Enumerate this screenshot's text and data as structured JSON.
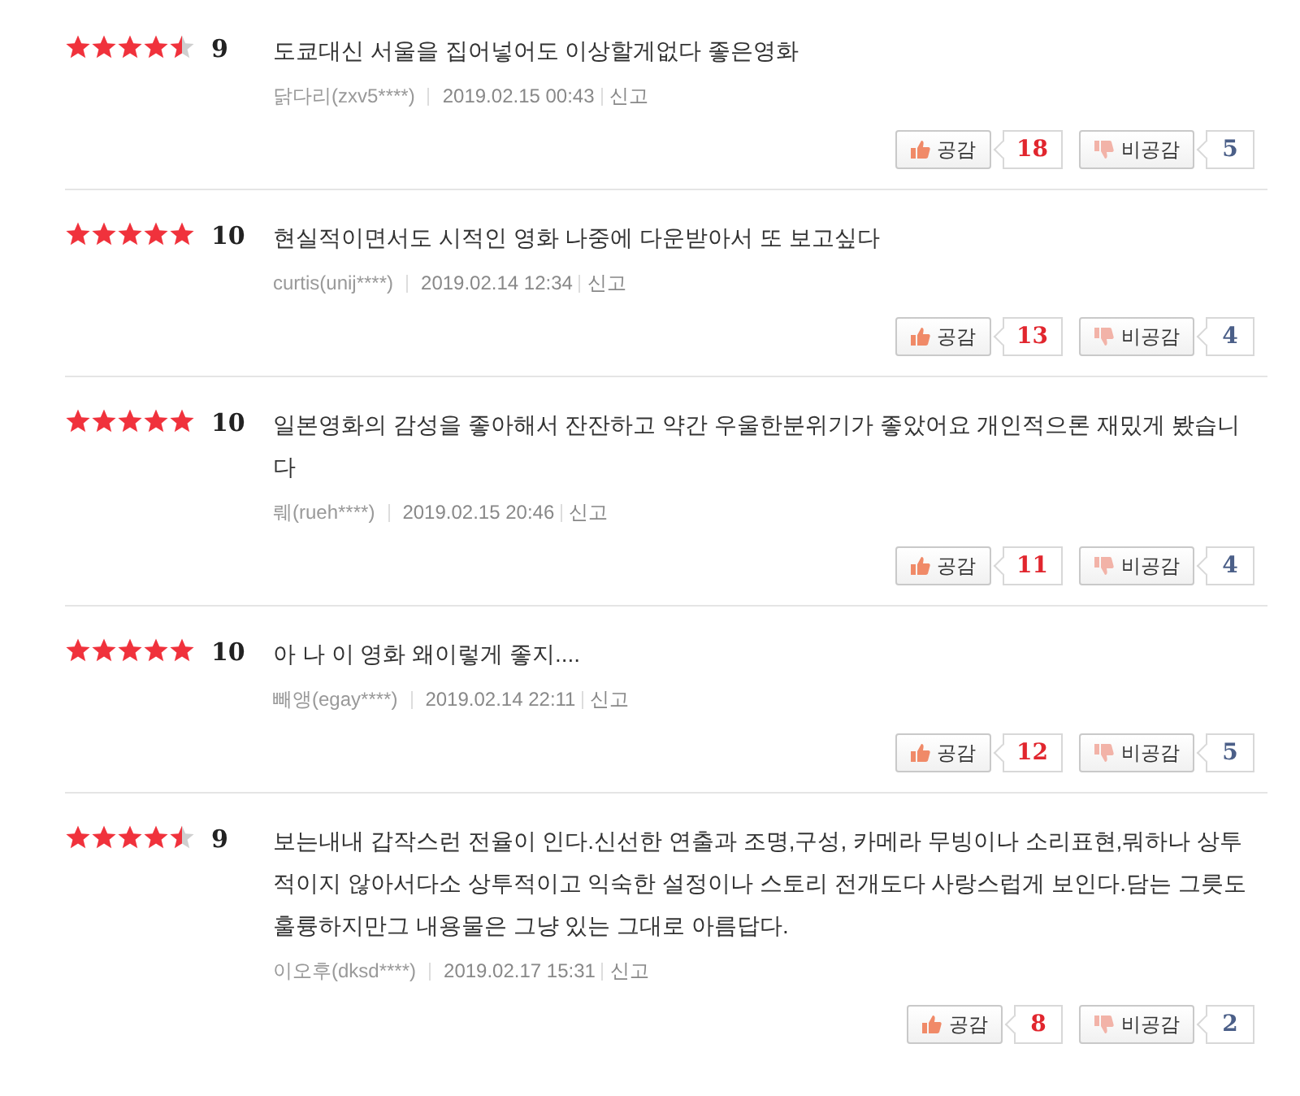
{
  "reviews": [
    {
      "stars": 4.5,
      "score": "9",
      "text": "도쿄대신 서울을 집어넣어도 이상할게없다 좋은영화",
      "author": "닭다리(zxv5****)",
      "date": "2019.02.15 00:43",
      "report": "신고",
      "like_label": "공감",
      "likes": "18",
      "dislike_label": "비공감",
      "dislikes": "5"
    },
    {
      "stars": 5,
      "score": "10",
      "text": "현실적이면서도 시적인 영화 나중에 다운받아서 또 보고싶다",
      "author": "curtis(unij****)",
      "date": "2019.02.14 12:34",
      "report": "신고",
      "like_label": "공감",
      "likes": "13",
      "dislike_label": "비공감",
      "dislikes": "4"
    },
    {
      "stars": 5,
      "score": "10",
      "text": "일본영화의 감성을 좋아해서 잔잔하고 약간 우울한분위기가 좋았어요 개인적으론 재밌게 봤습니다",
      "author": "뤠(rueh****)",
      "date": "2019.02.15 20:46",
      "report": "신고",
      "like_label": "공감",
      "likes": "11",
      "dislike_label": "비공감",
      "dislikes": "4"
    },
    {
      "stars": 5,
      "score": "10",
      "text": "아 나 이 영화 왜이렇게 좋지....",
      "author": "빼앵(egay****)",
      "date": "2019.02.14 22:11",
      "report": "신고",
      "like_label": "공감",
      "likes": "12",
      "dislike_label": "비공감",
      "dislikes": "5"
    },
    {
      "stars": 4.5,
      "score": "9",
      "text": "보는내내 갑작스런 전율이 인다.신선한 연출과 조명,구성, 카메라 무빙이나 소리표현,뭐하나 상투적이지 않아서다소 상투적이고 익숙한 설정이나 스토리 전개도다 사랑스럽게 보인다.담는 그릇도 훌륭하지만그 내용물은 그냥 있는 그대로 아름답다.",
      "author": "이오후(dksd****)",
      "date": "2019.02.17 15:31",
      "report": "신고",
      "like_label": "공감",
      "likes": "8",
      "dislike_label": "비공감",
      "dislikes": "2"
    }
  ]
}
